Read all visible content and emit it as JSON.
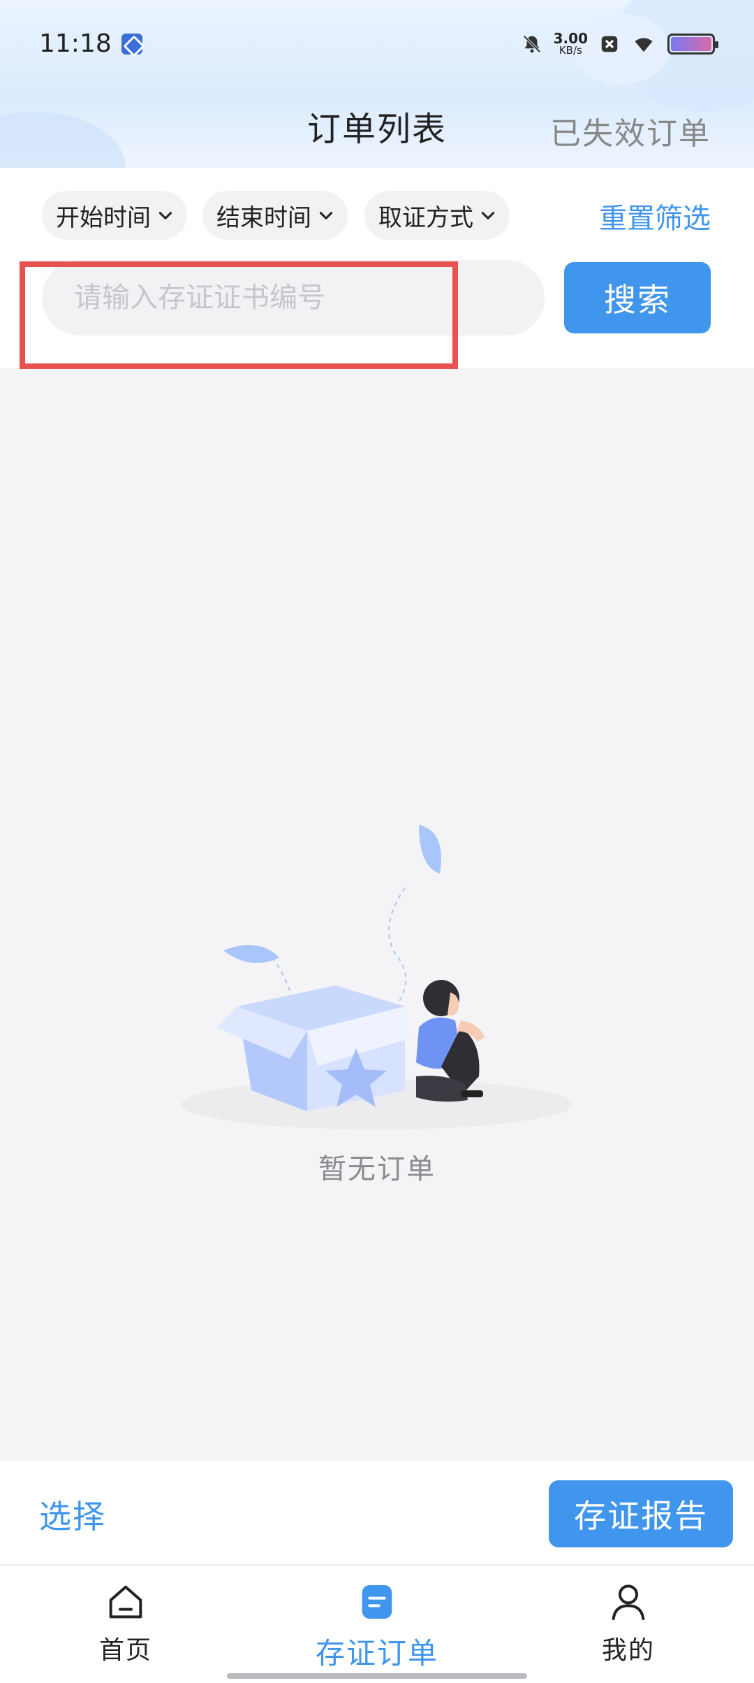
{
  "status_bar": {
    "time": "11:18",
    "net_speed_value": "3.00",
    "net_speed_unit": "KB/s",
    "icons": [
      "app-badge-icon",
      "bell-muted-icon",
      "close-box-icon",
      "wifi-icon",
      "battery-icon"
    ]
  },
  "header": {
    "title": "订单列表",
    "invalid_orders_link": "已失效订单"
  },
  "filters": {
    "start_time": "开始时间",
    "end_time": "结束时间",
    "evidence_method": "取证方式",
    "reset": "重置筛选"
  },
  "search": {
    "placeholder": "请输入存证证书编号",
    "value": "",
    "button": "搜索"
  },
  "empty_state": {
    "text": "暂无订单",
    "illustration": "empty-box-person-illustration"
  },
  "action_bar": {
    "select": "选择",
    "report": "存证报告"
  },
  "tab_bar": {
    "items": [
      {
        "label": "首页",
        "icon": "home-icon",
        "active": false
      },
      {
        "label": "存证订单",
        "icon": "document-icon",
        "active": true
      },
      {
        "label": "我的",
        "icon": "user-icon",
        "active": false
      }
    ]
  },
  "colors": {
    "accent": "#3f96ec",
    "highlight_border": "#e8524f",
    "background": "#f4f4f6"
  }
}
